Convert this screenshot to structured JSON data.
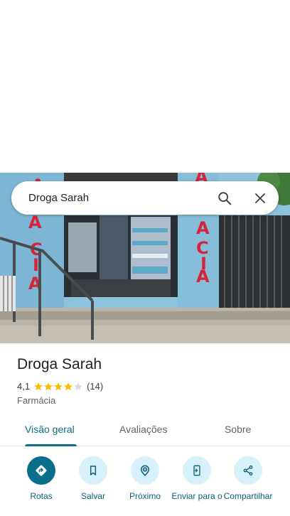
{
  "search": {
    "query": "Droga Sarah"
  },
  "place": {
    "name": "Droga Sarah",
    "rating": "4,1",
    "rating_value": 4.1,
    "review_count": "(14)",
    "category": "Farmácia"
  },
  "tabs": [
    {
      "label": "Visão geral",
      "active": true
    },
    {
      "label": "Avaliações",
      "active": false
    },
    {
      "label": "Sobre",
      "active": false
    }
  ],
  "actions": [
    {
      "label": "Rotas",
      "icon": "directions-icon"
    },
    {
      "label": "Salvar",
      "icon": "bookmark-icon"
    },
    {
      "label": "Próximo",
      "icon": "nearby-icon"
    },
    {
      "label": "Enviar para o",
      "icon": "send-to-phone-icon"
    },
    {
      "label": "Compartilhar",
      "icon": "share-icon"
    }
  ],
  "photo": {
    "sign_text": "ACIA"
  },
  "colors": {
    "accent": "#0b6e8a",
    "action_bg": "#d7f1fb",
    "star": "#fbbc04"
  }
}
